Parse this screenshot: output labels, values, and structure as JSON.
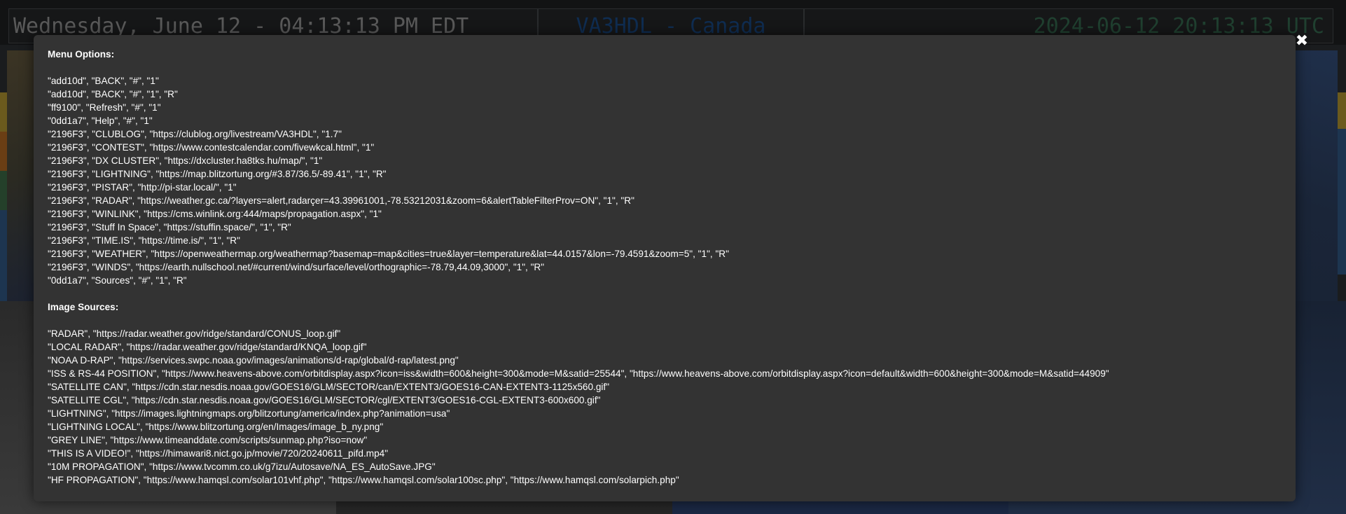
{
  "header": {
    "local_time": "Wednesday, June 12 - 04:13:13 PM EDT",
    "callsign": "VA3HDL - Canada",
    "utc_time": "2024-06-12 20:13:13 UTC"
  },
  "modal": {
    "close_glyph": "✖",
    "menu_heading": "Menu Options:",
    "menu_lines": [
      "\"add10d\", \"BACK\", \"#\", \"1\"",
      "\"add10d\", \"BACK\", \"#\", \"1\", \"R\"",
      "\"ff9100\", \"Refresh\", \"#\", \"1\"",
      "\"0dd1a7\", \"Help\", \"#\", \"1\"",
      "\"2196F3\", \"CLUBLOG\", \"https://clublog.org/livestream/VA3HDL\", \"1.7\"",
      "\"2196F3\", \"CONTEST\", \"https://www.contestcalendar.com/fivewkcal.html\", \"1\"",
      "\"2196F3\", \"DX CLUSTER\", \"https://dxcluster.ha8tks.hu/map/\", \"1\"",
      "\"2196F3\", \"LIGHTNING\", \"https://map.blitzortung.org/#3.87/36.5/-89.41\", \"1\", \"R\"",
      "\"2196F3\", \"PISTAR\", \"http://pi-star.local/\", \"1\"",
      "\"2196F3\", \"RADAR\", \"https://weather.gc.ca/?layers=alert,radarçer=43.39961001,-78.53212031&zoom=6&alertTableFilterProv=ON\", \"1\", \"R\"",
      "\"2196F3\", \"WINLINK\", \"https://cms.winlink.org:444/maps/propagation.aspx\", \"1\"",
      "\"2196F3\", \"Stuff In Space\", \"https://stuffin.space/\", \"1\", \"R\"",
      "\"2196F3\", \"TIME.IS\", \"https://time.is/\", \"1\", \"R\"",
      "\"2196F3\", \"WEATHER\", \"https://openweathermap.org/weathermap?basemap=map&cities=true&layer=temperature&lat=44.0157&lon=-79.4591&zoom=5\", \"1\", \"R\"",
      "\"2196F3\", \"WINDS\", \"https://earth.nullschool.net/#current/wind/surface/level/orthographic=-78.79,44.09,3000\", \"1\", \"R\"",
      "\"0dd1a7\", \"Sources\", \"#\", \"1\", \"R\""
    ],
    "sources_heading": "Image Sources:",
    "source_lines": [
      "\"RADAR\", \"https://radar.weather.gov/ridge/standard/CONUS_loop.gif\"",
      "\"LOCAL RADAR\", \"https://radar.weather.gov/ridge/standard/KNQA_loop.gif\"",
      "\"NOAA D-RAP\", \"https://services.swpc.noaa.gov/images/animations/d-rap/global/d-rap/latest.png\"",
      "\"ISS & RS-44 POSITION\", \"https://www.heavens-above.com/orbitdisplay.aspx?icon=iss&width=600&height=300&mode=M&satid=25544\", \"https://www.heavens-above.com/orbitdisplay.aspx?icon=default&width=600&height=300&mode=M&satid=44909\"",
      "\"SATELLITE CAN\", \"https://cdn.star.nesdis.noaa.gov/GOES16/GLM/SECTOR/can/EXTENT3/GOES16-CAN-EXTENT3-1125x560.gif\"",
      "\"SATELLITE CGL\", \"https://cdn.star.nesdis.noaa.gov/GOES16/GLM/SECTOR/cgl/EXTENT3/GOES16-CGL-EXTENT3-600x600.gif\"",
      "\"LIGHTNING\", \"https://images.lightningmaps.org/blitzortung/america/index.php?animation=usa\"",
      "\"LIGHTNING LOCAL\", \"https://www.blitzortung.org/en/Images/image_b_ny.png\"",
      "\"GREY LINE\", \"https://www.timeanddate.com/scripts/sunmap.php?iso=now\"",
      "\"THIS IS A VIDEO!\", \"https://himawari8.nict.go.jp/movie/720/20240611_pifd.mp4\"",
      "\"10M PROPAGATION\", \"https://www.tvcomm.co.uk/g7izu/Autosave/NA_ES_AutoSave.JPG\"",
      "\"HF PROPAGATION\", \"https://www.hamqsl.com/solar101vhf.php\", \"https://www.hamqsl.com/solar100sc.php\", \"https://www.hamqsl.com/solarpich.php\""
    ]
  }
}
